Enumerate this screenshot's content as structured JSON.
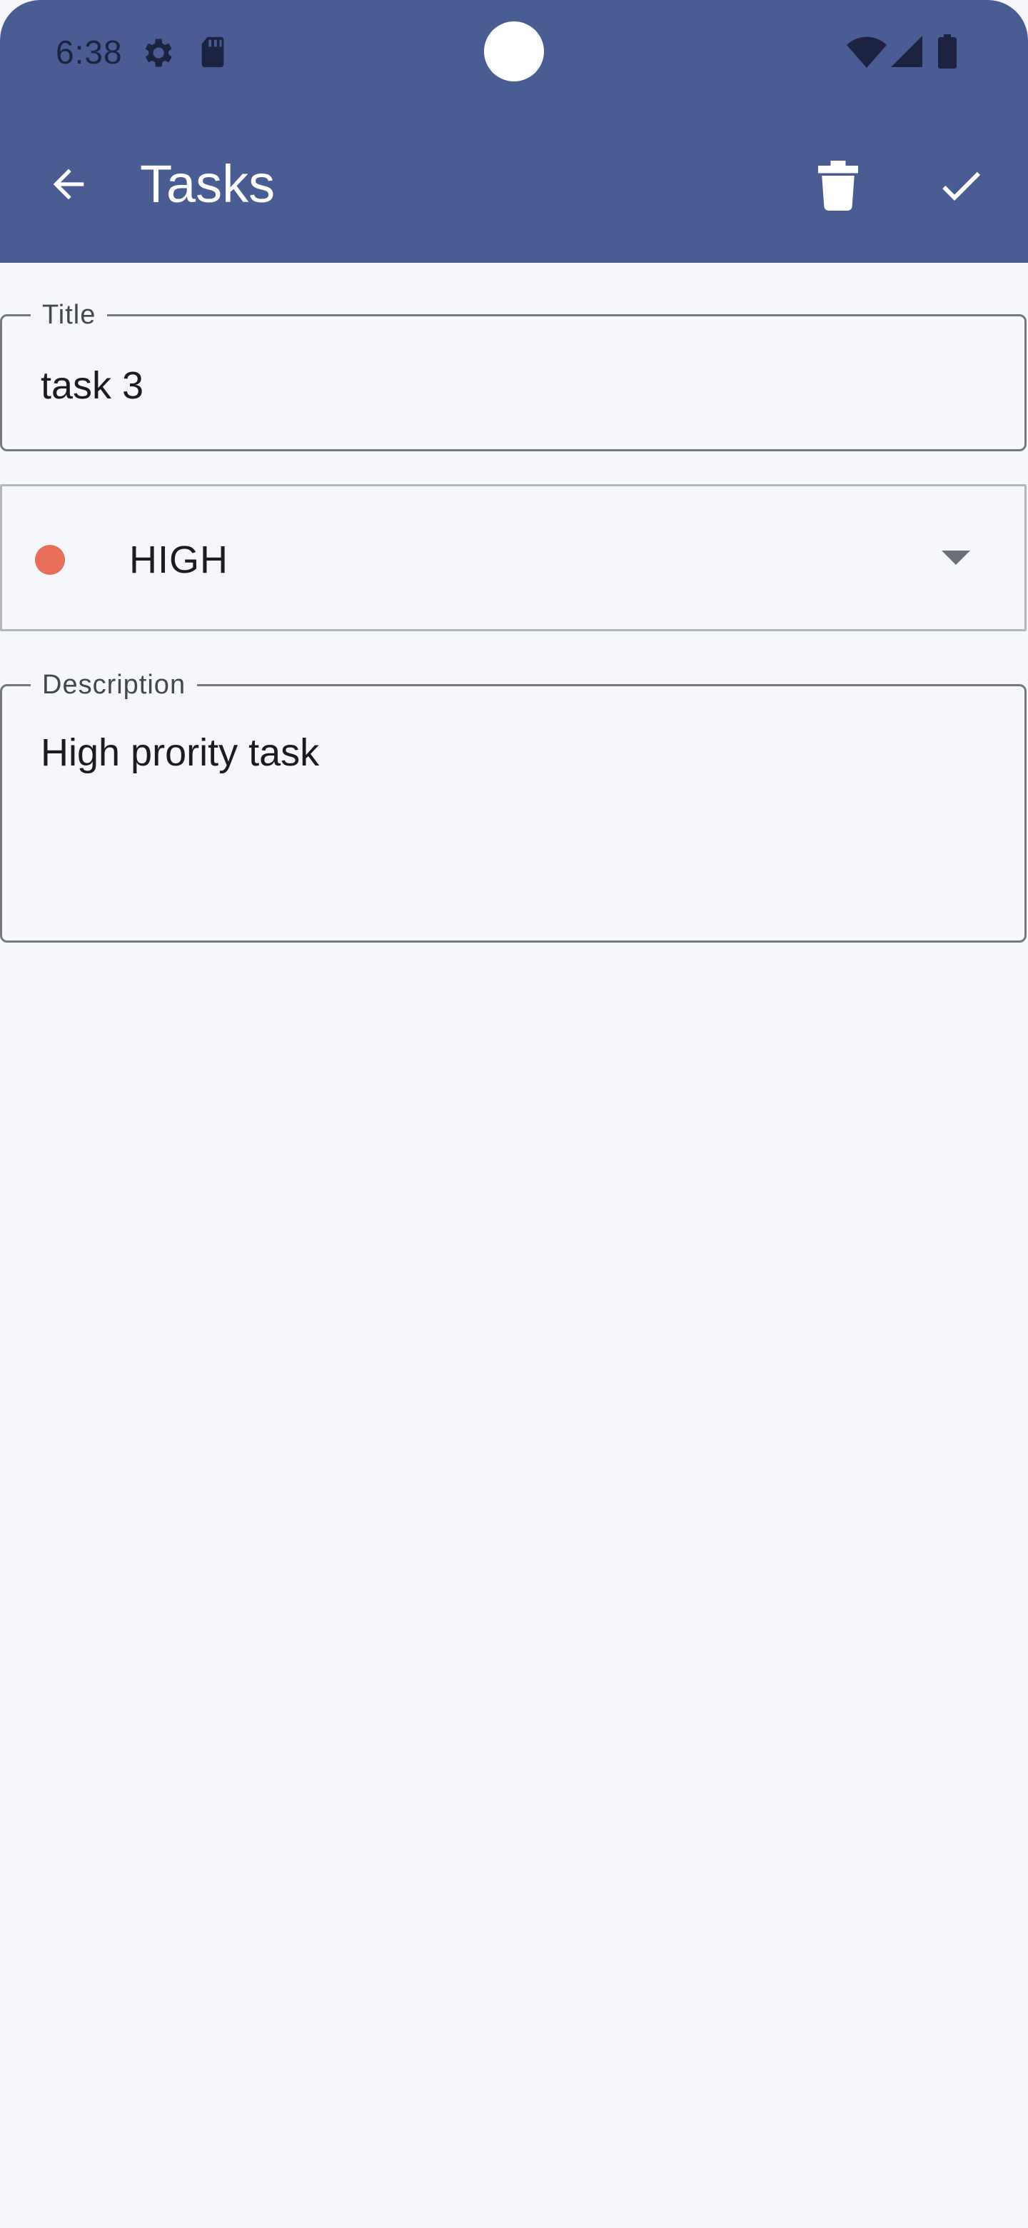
{
  "status_bar": {
    "time": "6:38",
    "icons": [
      "gear-icon",
      "sd-card-icon",
      "wifi-icon",
      "cell-signal-icon",
      "battery-icon"
    ]
  },
  "app_bar": {
    "title": "Tasks",
    "back_icon": "arrow-back-icon",
    "delete_icon": "trash-icon",
    "confirm_icon": "check-icon",
    "background_color": "#4a5d93"
  },
  "form": {
    "title_field": {
      "label": "Title",
      "value": "task 3"
    },
    "priority_field": {
      "value": "HIGH",
      "dot_color": "#e96e5a",
      "dropdown_icon": "dropdown-arrow-icon"
    },
    "description_field": {
      "label": "Description",
      "value": "High prority task"
    }
  }
}
